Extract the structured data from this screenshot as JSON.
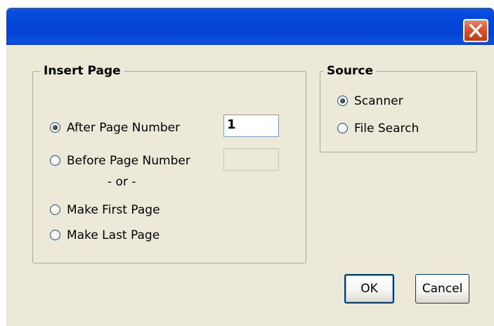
{
  "window": {
    "title": "",
    "close_icon": "close-x-icon",
    "close_color": "#d8532e",
    "titlebar_color": "#0346d8"
  },
  "insert_page": {
    "title": "Insert Page",
    "options": {
      "after": {
        "label": "After Page Number",
        "checked": true,
        "value": "1"
      },
      "before": {
        "label": "Before Page Number",
        "checked": false,
        "value": ""
      },
      "or_text": "- or -",
      "first": {
        "label": "Make First Page",
        "checked": false
      },
      "last": {
        "label": "Make Last Page",
        "checked": false
      }
    }
  },
  "source": {
    "title": "Source",
    "options": {
      "scanner": {
        "label": "Scanner",
        "checked": true
      },
      "file_search": {
        "label": "File Search",
        "checked": false
      }
    }
  },
  "buttons": {
    "ok": {
      "label": "OK"
    },
    "cancel": {
      "label": "Cancel"
    }
  }
}
